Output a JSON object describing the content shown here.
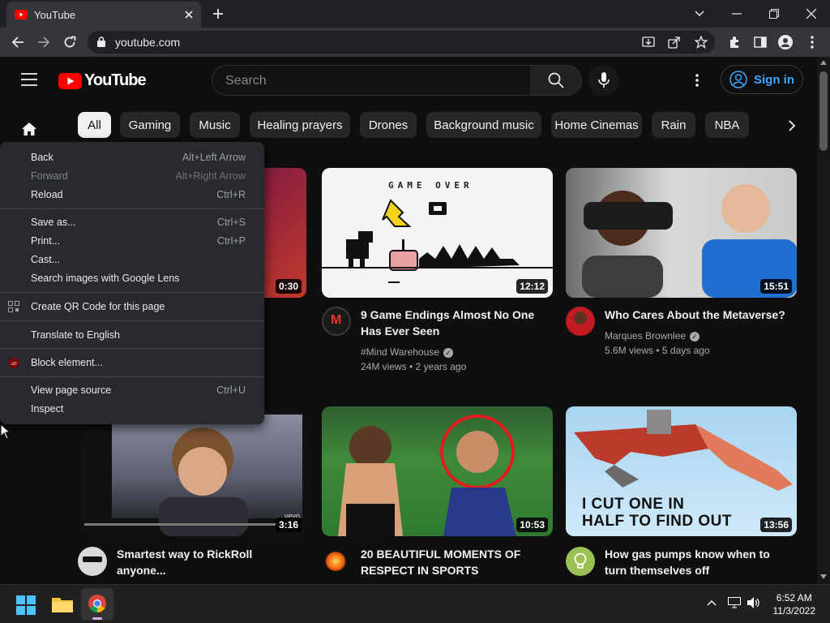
{
  "browser": {
    "tab_title": "YouTube",
    "url": "youtube.com"
  },
  "youtube": {
    "logo_text": "YouTube",
    "search_placeholder": "Search",
    "signin_label": "Sign in",
    "chips": [
      "All",
      "Gaming",
      "Music",
      "Healing prayers",
      "Drones",
      "Background music",
      "Home Cinemas",
      "Rain",
      "NBA"
    ],
    "videos": [
      {
        "title": "",
        "channel": "",
        "meta": "",
        "duration": "0:30"
      },
      {
        "title_lines": [
          "9 Game Endings Almost No One",
          "Has Ever Seen"
        ],
        "channel": "#Mind Warehouse",
        "meta": "24M views • 2 years ago",
        "duration": "12:12",
        "thumb_text": "GAME OVER"
      },
      {
        "title_lines": [
          "Who Cares About the Metaverse?"
        ],
        "channel": "Marques Brownlee",
        "meta": "5.6M views • 5 days ago",
        "duration": "15:51"
      },
      {
        "title_lines": [
          "Smartest way to RickRoll",
          "anyone..."
        ],
        "duration": "3:16",
        "thumb_text": "vevo"
      },
      {
        "title_lines": [
          "20 BEAUTIFUL MOMENTS OF",
          "RESPECT IN SPORTS"
        ],
        "duration": "10:53"
      },
      {
        "title_lines": [
          "How gas pumps know when to",
          "turn themselves off"
        ],
        "duration": "13:56",
        "thumb_text_lines": [
          "I CUT ONE IN",
          "HALF TO FIND OUT"
        ]
      }
    ]
  },
  "context_menu": {
    "items": [
      {
        "label": "Back",
        "shortcut": "Alt+Left Arrow"
      },
      {
        "label": "Forward",
        "shortcut": "Alt+Right Arrow",
        "disabled": true
      },
      {
        "label": "Reload",
        "shortcut": "Ctrl+R"
      },
      {
        "label": "Save as...",
        "shortcut": "Ctrl+S"
      },
      {
        "label": "Print...",
        "shortcut": "Ctrl+P"
      },
      {
        "label": "Cast...",
        "shortcut": ""
      },
      {
        "label": "Search images with Google Lens",
        "shortcut": ""
      },
      {
        "label": "Create QR Code for this page",
        "shortcut": ""
      },
      {
        "label": "Translate to English",
        "shortcut": ""
      },
      {
        "label": "Block element...",
        "shortcut": ""
      },
      {
        "label": "View page source",
        "shortcut": "Ctrl+U"
      },
      {
        "label": "Inspect",
        "shortcut": ""
      }
    ]
  },
  "taskbar": {
    "time": "6:52 AM",
    "date": "11/3/2022"
  }
}
